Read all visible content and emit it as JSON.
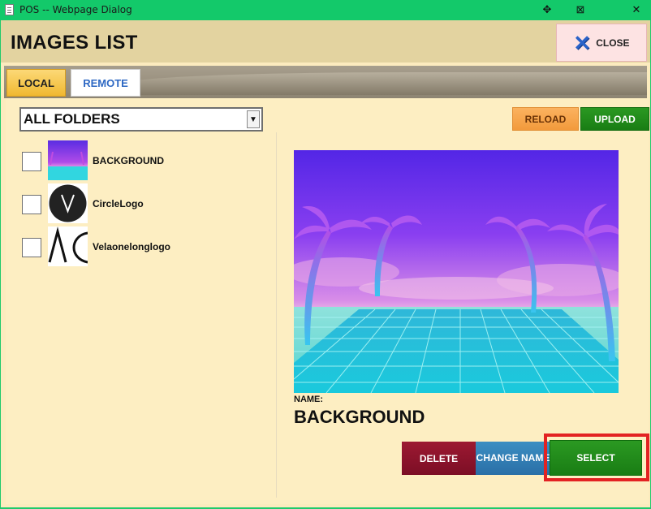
{
  "window": {
    "title": "POS -- Webpage Dialog",
    "controls": {
      "pin": "✥",
      "restore": "⊠",
      "close": "✕"
    }
  },
  "header": {
    "title": "IMAGES LIST",
    "close_label": "CLOSE"
  },
  "tabs": [
    {
      "label": "LOCAL",
      "active": true
    },
    {
      "label": "REMOTE",
      "active": false
    }
  ],
  "folder_filter": {
    "selected": "ALL FOLDERS"
  },
  "toolbar": {
    "reload_label": "RELOAD",
    "upload_label": "UPLOAD"
  },
  "images": [
    {
      "name": "BACKGROUND",
      "checked": false,
      "thumb": "synthwave-icon"
    },
    {
      "name": "CircleLogo",
      "checked": false,
      "thumb": "circle-v-logo-icon"
    },
    {
      "name": "Velaonelonglogo",
      "checked": false,
      "thumb": "vela-logo-icon"
    }
  ],
  "detail": {
    "name_label": "NAME:",
    "name_value": "BACKGROUND",
    "delete_label": "DELETE",
    "change_name_label": "CHANGE NAME",
    "select_label": "SELECT"
  },
  "colors": {
    "titlebar": "#13c96a",
    "header_bg": "#e3d3a0",
    "content_bg": "#fdeec2",
    "upload_green": "#1f8a18",
    "reload_orange": "#f5a349",
    "delete_red": "#8c1329",
    "change_blue": "#3380b6",
    "highlight_red": "#e32222"
  }
}
